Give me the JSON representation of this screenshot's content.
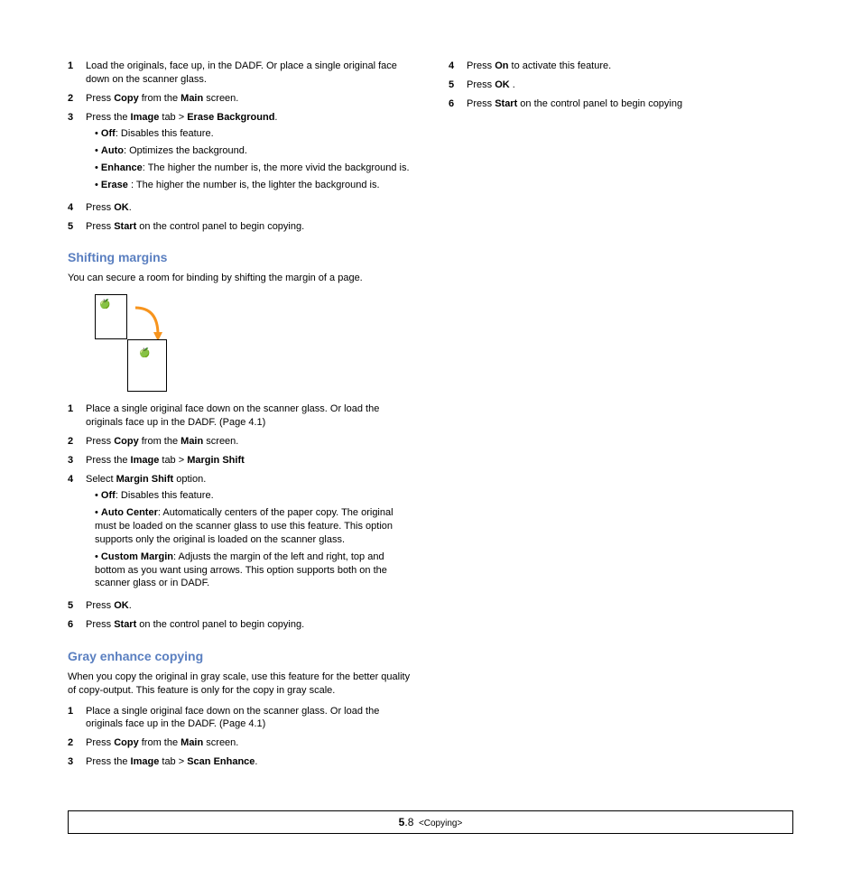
{
  "leftTop": {
    "step1": "Load the originals, face up, in the DADF. Or place a single original face down on the scanner glass.",
    "step2_a": "Press ",
    "step2_b": "Copy",
    "step2_c": " from the ",
    "step2_d": "Main",
    "step2_e": " screen.",
    "step3_a": "Press the ",
    "step3_b": "Image",
    "step3_c": " tab > ",
    "step3_d": "Erase Background",
    "step3_e": ".",
    "bullet1_a": "Off",
    "bullet1_b": ": Disables this feature.",
    "bullet2_a": "Auto",
    "bullet2_b": ": Optimizes the background.",
    "bullet3_a": "Enhance",
    "bullet3_b": ": The higher the number is, the more vivid the background is.",
    "bullet4_a": "Erase",
    "bullet4_b": " : The higher the number is, the lighter the background is.",
    "step4_a": "Press ",
    "step4_b": "OK",
    "step4_c": ".",
    "step5_a": "Press ",
    "step5_b": "Start",
    "step5_c": " on the control panel to begin copying."
  },
  "shifting": {
    "title": "Shifting margins",
    "intro": "You can secure a room for binding by shifting the margin of a page.",
    "step1": "Place a single original face down on the scanner glass. Or load the originals face up in the DADF. (Page 4.1)",
    "step2_a": "Press ",
    "step2_b": "Copy",
    "step2_c": " from the ",
    "step2_d": "Main",
    "step2_e": " screen.",
    "step3_a": "Press the ",
    "step3_b": "Image",
    "step3_c": " tab > ",
    "step3_d": "Margin Shift",
    "step4_a": "Select ",
    "step4_b": "Margin Shift",
    "step4_c": " option.",
    "b1_a": "Off",
    "b1_b": ": Disables this feature.",
    "b2_a": "Auto Center",
    "b2_b": ": Automatically centers of the paper copy. The original must be loaded on the scanner glass to use this feature. This option supports only the original is loaded on the scanner glass.",
    "b3_a": "Custom Margin",
    "b3_b": ": Adjusts the margin of the left and right, top and bottom as you want using arrows. This option supports both on the scanner glass or in DADF.",
    "step5_a": "Press ",
    "step5_b": "OK",
    "step5_c": ".",
    "step6_a": "Press ",
    "step6_b": "Start",
    "step6_c": " on the control panel to begin copying."
  },
  "gray": {
    "title": "Gray enhance copying",
    "intro": "When you copy the original in gray scale, use this feature for the better quality of copy-output. This feature is only for the copy in gray scale.",
    "step1": "Place a single original face down on the scanner glass. Or load the originals face up in the DADF. (Page 4.1)",
    "step2_a": "Press ",
    "step2_b": "Copy",
    "step2_c": " from the ",
    "step2_d": "Main",
    "step2_e": " screen.",
    "step3_a": "Press the ",
    "step3_b": "Image",
    "step3_c": " tab > ",
    "step3_d": "Scan Enhance",
    "step3_e": "."
  },
  "right": {
    "step4_a": "Press ",
    "step4_b": "On",
    "step4_c": " to activate this feature.",
    "step5_a": "Press ",
    "step5_b": "OK",
    "step5_c": " .",
    "step6_a": "Press ",
    "step6_b": "Start",
    "step6_c": " on the control panel to begin copying"
  },
  "footer": {
    "chapter": "5",
    "page": ".8",
    "section": "<Copying>"
  }
}
